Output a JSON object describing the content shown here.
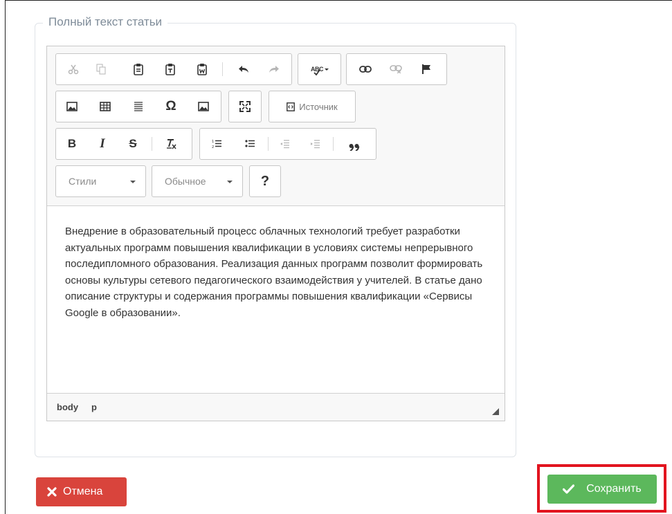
{
  "fieldset": {
    "legend": "Полный текст статьи"
  },
  "toolbar": {
    "source_label": "Источник",
    "styles_label": "Стили",
    "format_label": "Обычное",
    "help_label": "?",
    "bold_label": "B",
    "italic_label": "I",
    "strike_label": "S",
    "omega_label": "Ω",
    "spell_label": "ABC"
  },
  "content": {
    "paragraph": "Внедрение в образовательный процесс облачных технологий требует разработки актуальных программ повышения квалификации в условиях системы непрерывного последипломного образования. Реализация данных программ позволит формировать основы культуры сетевого педагогического взаимодействия у учителей. В статье дано описание структуры и содержания программы повышения квалификации «Сервисы Google в образовании»."
  },
  "pathbar": {
    "crumbs": [
      "body",
      "p"
    ]
  },
  "actions": {
    "cancel_label": "Отмена",
    "save_label": "Сохранить"
  },
  "colors": {
    "cancel": "#d9443c",
    "save": "#5cb85c",
    "highlight": "#e2141f"
  }
}
